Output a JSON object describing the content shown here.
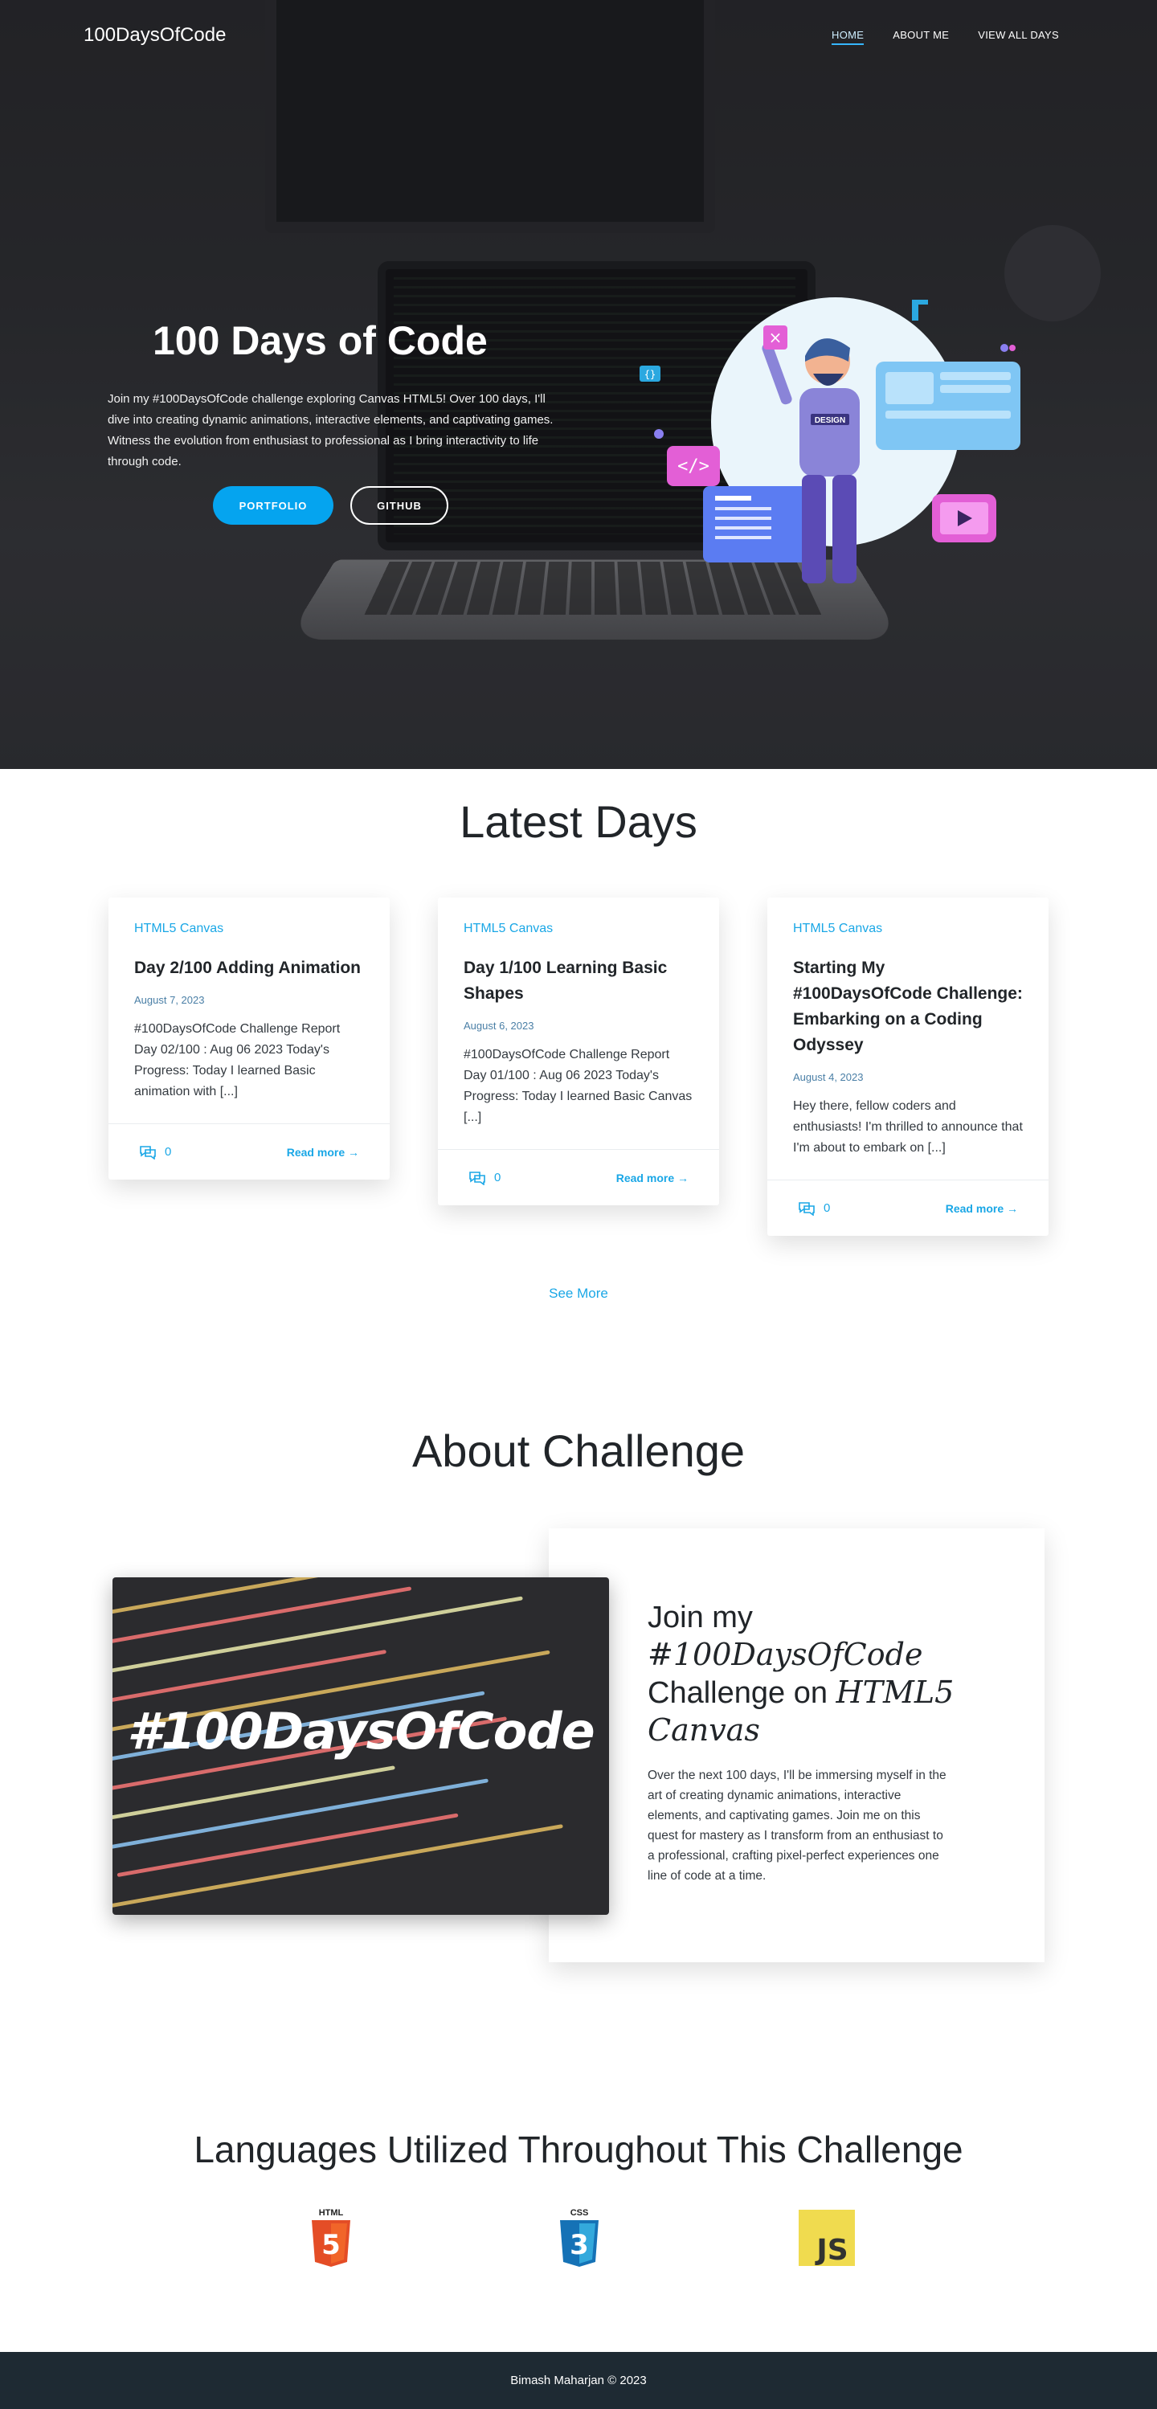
{
  "nav": {
    "brand": "100DaysOfCode",
    "links": [
      "HOME",
      "ABOUT ME",
      "VIEW ALL DAYS"
    ]
  },
  "hero": {
    "title": "100 Days of Code",
    "description": "Join my #100DaysOfCode challenge exploring Canvas HTML5! Over 100 days, I'll dive into creating dynamic animations, interactive elements, and captivating games. Witness the evolution from enthusiast to professional as I bring interactivity to life through code.",
    "portfolio_label": "PORTFOLIO",
    "github_label": "GITHUB",
    "illustration_badge": "DESIGN"
  },
  "latest": {
    "title": "Latest Days",
    "cards": [
      {
        "category": "HTML5 Canvas",
        "title": "Day 2/100 Adding Animation",
        "date": "August 7, 2023",
        "excerpt": "#100DaysOfCode Challenge Report Day 02/100 : Aug 06 2023 Today's Progress: Today I learned Basic animation with [...]",
        "comments": "0",
        "read_more": "Read more →"
      },
      {
        "category": "HTML5 Canvas",
        "title": "Day 1/100 Learning Basic Shapes",
        "date": "August 6, 2023",
        "excerpt": "#100DaysOfCode Challenge Report Day 01/100 : Aug 06 2023 Today's Progress: Today I learned Basic Canvas [...]",
        "comments": "0",
        "read_more": "Read more →"
      },
      {
        "category": "HTML5 Canvas",
        "title": "Starting My #100DaysOfCode Challenge: Embarking on a Coding Odyssey",
        "date": "August 4, 2023",
        "excerpt": "Hey there, fellow coders and enthusiasts! I'm thrilled to announce that I'm about to embark on [...]",
        "comments": "0",
        "read_more": "Read more →"
      }
    ],
    "see_more": "See More"
  },
  "about": {
    "title": "About Challenge",
    "image_caption": "#100DaysOfCode",
    "heading_part1": "Join my ",
    "heading_italic1": "#100DaysOfCode",
    "heading_part2": " Challenge on ",
    "heading_italic2": "HTML5 Canvas",
    "text": "Over the next 100 days, I'll be immersing myself in the art of creating dynamic animations, interactive elements, and captivating games. Join me on this quest for mastery as I transform from an enthusiast to a professional, crafting pixel-perfect experiences one line of code at a time."
  },
  "languages": {
    "title": "Languages Utilized Throughout This Challenge",
    "items": [
      {
        "icon": "html5-icon",
        "label": "HTML",
        "glyph": "5",
        "color": "#e44d26"
      },
      {
        "icon": "css3-icon",
        "label": "CSS",
        "glyph": "3",
        "color": "#1572b6"
      },
      {
        "icon": "javascript-icon",
        "label": "JS",
        "glyph": "JS",
        "color": "#f0db4f"
      }
    ]
  },
  "footer": {
    "text": "Bimash Maharjan © 2023"
  },
  "colors": {
    "accent": "#05a4ef",
    "link": "#1aa7e6",
    "footer_bg": "#1e2a33"
  }
}
